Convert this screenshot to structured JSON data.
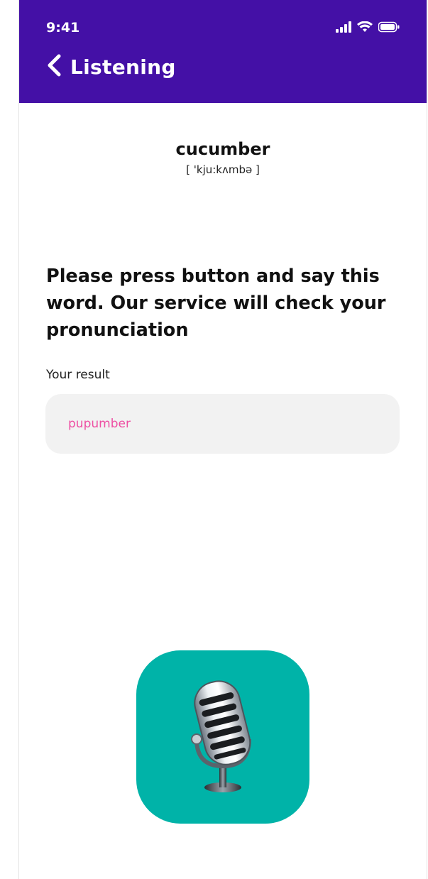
{
  "status_bar": {
    "time": "9:41"
  },
  "header": {
    "title": "Listening",
    "back_icon": "chevron-left-icon",
    "background": "#4410a6"
  },
  "word": {
    "text": "cucumber",
    "transcription": "[ 'kju:kʌmbə ]"
  },
  "instruction": "Please press button and say this word. Our service will check your pronunciation",
  "result": {
    "label": "Your result",
    "value": "pupumber",
    "value_color": "#ee4fa3"
  },
  "mic_button": {
    "icon": "microphone-icon",
    "background": "#00b3a8"
  }
}
